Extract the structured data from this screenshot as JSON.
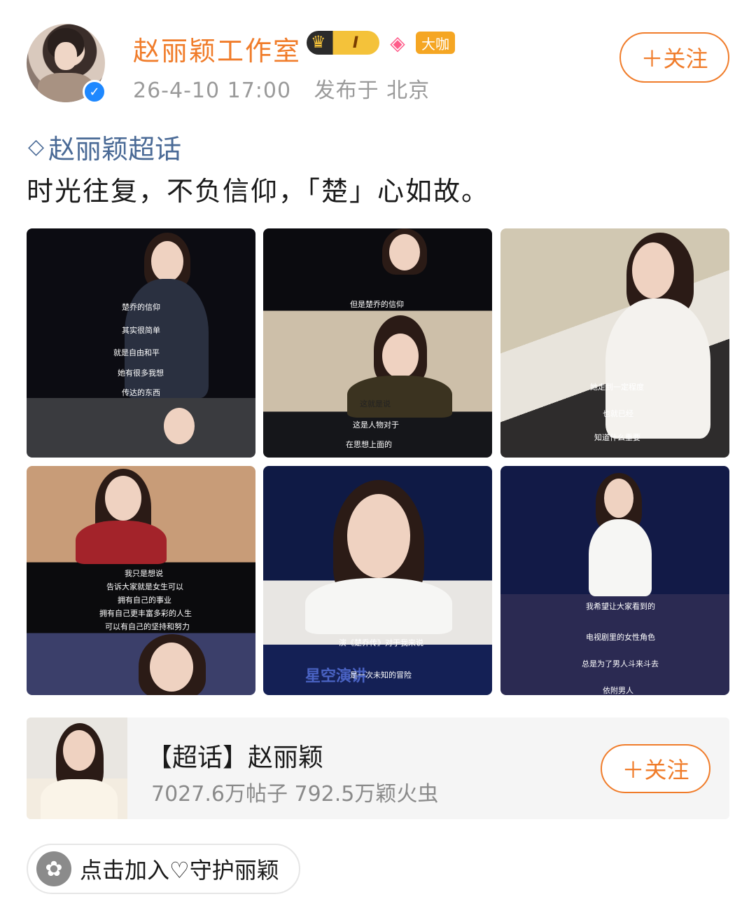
{
  "post": {
    "author": {
      "name": "赵丽颖工作室",
      "vip_level": "I",
      "rank_badge": "大咖",
      "verified_icon": "verified-check-icon"
    },
    "meta": {
      "timestamp": "26-4-10 17:00",
      "location": "发布于 北京"
    },
    "follow_label": "＋关注",
    "topic_tag": "赵丽颖超话",
    "text": "时光往复，不负信仰，「楚」心如故。",
    "images": [
      {
        "captions": [
          "楚乔的信仰",
          "其实很简单",
          "就是自由和平",
          "她有很多我想",
          "传达的东西"
        ]
      },
      {
        "captions": [
          "但是楚乔的信仰",
          "这就是说",
          "这是人物对于",
          "在思想上面的"
        ]
      },
      {
        "captions": [
          "她走到一定程度",
          "也就已经",
          "知道什么重要"
        ]
      },
      {
        "captions": [
          "我只是想说",
          "告诉大家就是女生可以",
          "拥有自己的事业",
          "拥有自己更丰富多彩的人生",
          "可以有自己的坚持和努力"
        ]
      },
      {
        "captions": [
          "演《楚乔传》对于我来说",
          "是一次未知的冒险",
          "星空演讲"
        ]
      },
      {
        "captions": [
          "我希望让大家看到的",
          "电视剧里的女性角色",
          "总是为了男人斗来斗去",
          "依附男人"
        ]
      }
    ]
  },
  "topic_card": {
    "title": "【超话】赵丽颖",
    "stats": "7027.6万帖子 792.5万颖火虫",
    "follow_label": "＋关注"
  },
  "join": {
    "label": "点击加入♡守护丽颖"
  },
  "colors": {
    "accent": "#f07c2a",
    "link": "#4a6a96",
    "verified": "#1e88ff"
  }
}
